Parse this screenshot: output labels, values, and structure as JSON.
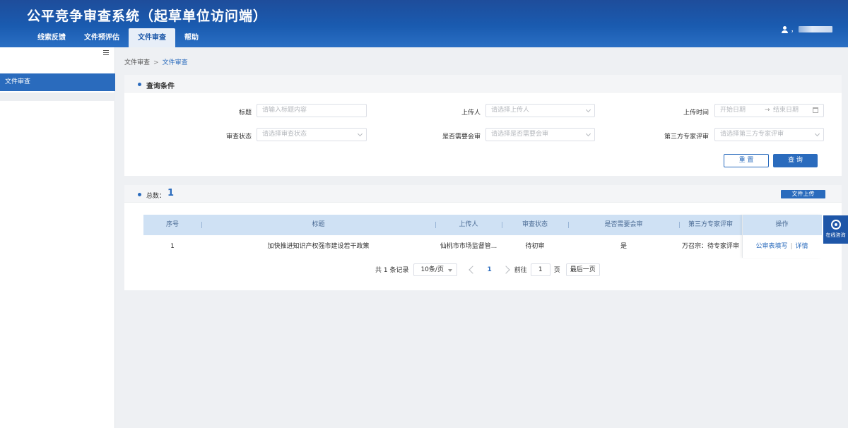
{
  "app": {
    "title": "公平竞争审查系统（起草单位访问端）"
  },
  "nav": {
    "tabs": [
      {
        "label": "线索反馈"
      },
      {
        "label": "文件预评估"
      },
      {
        "label": "文件审查"
      },
      {
        "label": "帮助"
      }
    ],
    "active": "文件审查"
  },
  "user": {
    "prefix": "，"
  },
  "sidebar": {
    "items": [
      {
        "label": "文件审查"
      }
    ]
  },
  "breadcrumb": {
    "root": "文件审查",
    "sep": ">",
    "current": "文件审查"
  },
  "query": {
    "title": "查询条件",
    "fields": {
      "title": {
        "label": "标题",
        "placeholder": "请输入标题内容"
      },
      "uploader": {
        "label": "上传人",
        "placeholder": "请选择上传人"
      },
      "upload_time": {
        "label": "上传时间",
        "start_placeholder": "开始日期",
        "arrow": "→",
        "end_placeholder": "结束日期"
      },
      "review_status": {
        "label": "审查状态",
        "placeholder": "请选择审查状态"
      },
      "joint_review": {
        "label": "是否需要会审",
        "placeholder": "请选择是否需要会审"
      },
      "expert_review": {
        "label": "第三方专家评审",
        "placeholder": "请选择第三方专家评审"
      }
    },
    "reset_label": "重 置",
    "search_label": "查 询"
  },
  "results": {
    "total_label": "总数：",
    "total": "1",
    "upload_label": "文件上传",
    "columns": [
      "序号",
      "标题",
      "上传人",
      "审查状态",
      "是否需要会审",
      "第三方专家评审",
      "操作"
    ],
    "rows": [
      {
        "index": "1",
        "title": "加快推进知识产权强市建设若干政策",
        "uploader": "仙桃市市场监督管...",
        "status": "待初审",
        "joint_review": "是",
        "expert_review": "万召宗：待专家评审",
        "action_fill": "公审表填写",
        "action_sep": "|",
        "action_detail": "详情"
      }
    ],
    "pager": {
      "summary": "共 1 条记录",
      "page_size": "10条/页",
      "current_page": "1",
      "goto_prefix": "前往",
      "goto_value": "1",
      "goto_suffix": "页",
      "last_label": "最后一页"
    }
  },
  "consult": {
    "label": "在线咨询"
  },
  "colors": {
    "header": "#1e4d9b",
    "accent": "#2a6bbd",
    "table_header": "#cfe1f4",
    "background": "#eef0f3"
  }
}
